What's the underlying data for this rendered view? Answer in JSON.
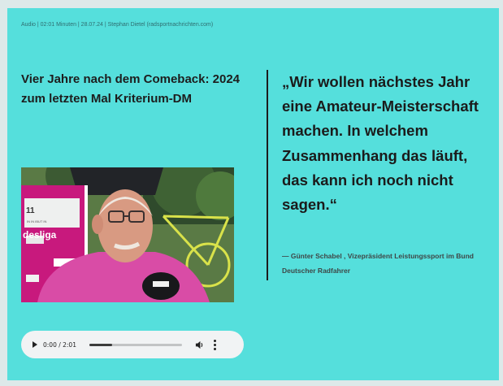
{
  "meta": {
    "byline": "Audio | 02:01 Minuten | 28.07.24 | Stephan Dietel (radsportnachrichten.com)"
  },
  "article": {
    "headline": "Vier Jahre nach dem Comeback: 2024 zum letzten Mal Kriterium-DM"
  },
  "video": {
    "backdrop_text": "desliga",
    "backdrop_small": "11",
    "backdrop_sub": "IN IN IBUT IN"
  },
  "audio_player": {
    "time": "0:00 / 2:01",
    "progress": 0.25
  },
  "quote": {
    "text": "„Wir wollen nächstes Jahr eine Amateur-Meisterschaft machen. In welchem Zusammenhang das läuft, das kann ich noch nicht sagen.“",
    "attribution": "— Günter Schabel , Vizepräsident Leistungssport im Bund Deutscher Radfahrer"
  },
  "colors": {
    "background": "#55dfdc",
    "text": "#1b1b1b",
    "banner_pink": "#c8197d",
    "shirt_pink": "#d94ca6"
  },
  "icons": [
    "play-icon",
    "volume-icon",
    "more-options-icon"
  ]
}
